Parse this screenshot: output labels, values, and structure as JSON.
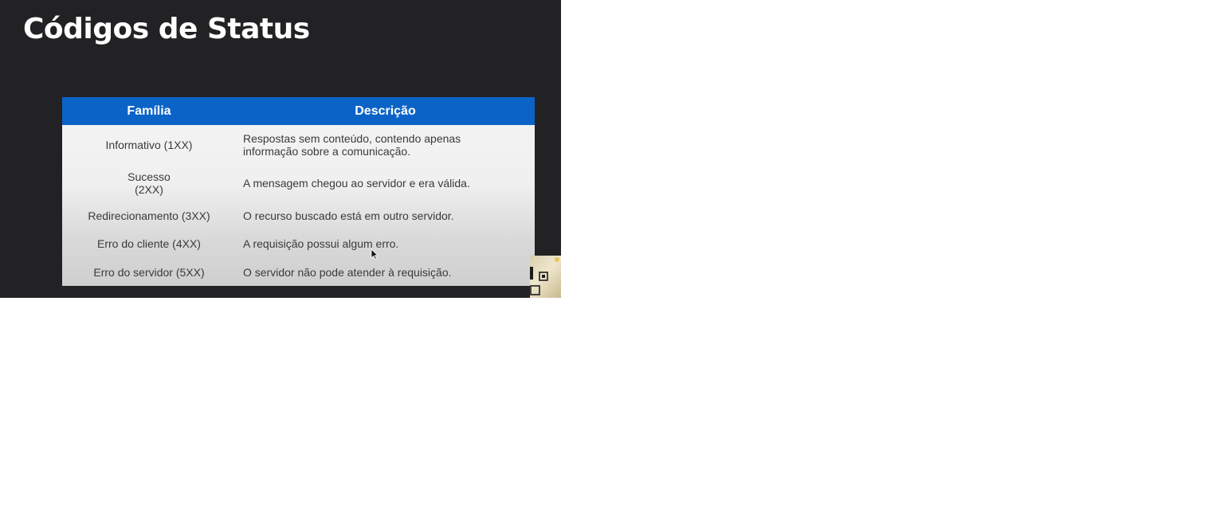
{
  "slide": {
    "title": "Códigos de Status"
  },
  "table": {
    "headers": {
      "family": "Família",
      "description": "Descrição"
    },
    "rows": [
      {
        "family": [
          "Informativo (1XX)"
        ],
        "description": [
          "Respostas sem conteúdo, contendo apenas",
          "informação sobre a comunicação."
        ]
      },
      {
        "family": [
          "Sucesso",
          "(2XX)"
        ],
        "description": [
          "A mensagem chegou ao servidor e era válida."
        ]
      },
      {
        "family": [
          "Redirecionamento (3XX)"
        ],
        "description": [
          "O recurso buscado está em outro servidor."
        ]
      },
      {
        "family": [
          "Erro do cliente (4XX)"
        ],
        "description": [
          "A requisição possui algum erro."
        ]
      },
      {
        "family": [
          "Erro do servidor (5XX)"
        ],
        "description": [
          "O servidor não pode atender à requisição."
        ]
      }
    ]
  },
  "colors": {
    "slide_background": "#222224",
    "header_background": "#0b63c8",
    "header_text": "#ffffff",
    "cell_text": "#3a3a3a"
  },
  "icons": {
    "cursor": "arrow-cursor-icon",
    "webcam": "webcam-overlay"
  }
}
